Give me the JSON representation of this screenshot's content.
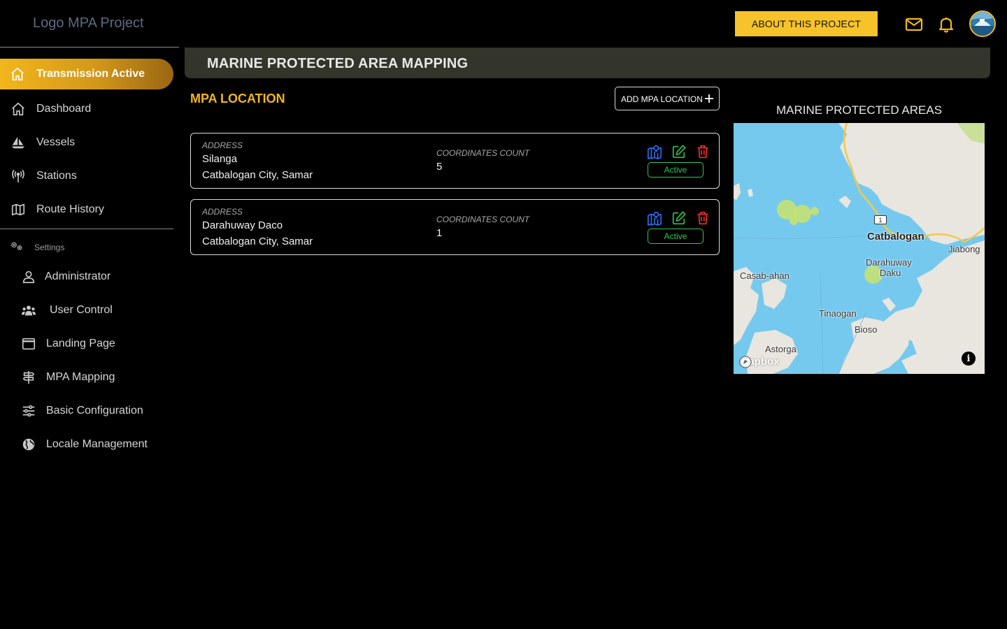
{
  "app": {
    "logo_text": "Logo MPA Project"
  },
  "topbar": {
    "about_label": "ABOUT THIS PROJECT",
    "mail_icon": "mail-icon",
    "bell_icon": "bell-icon"
  },
  "sidebar": {
    "active_item": {
      "label": "Transmission Active",
      "icon": "home-icon"
    },
    "items": [
      {
        "label": "Dashboard",
        "icon": "home-icon"
      },
      {
        "label": "Vessels",
        "icon": "sailboat-icon"
      },
      {
        "label": "Stations",
        "icon": "antenna-icon"
      },
      {
        "label": "Route History",
        "icon": "map-icon"
      }
    ],
    "settings_label": "Settings",
    "settings_items": [
      {
        "label": "Administrator",
        "icon": "user-icon"
      },
      {
        "label": "User Control",
        "icon": "users-icon"
      },
      {
        "label": "Landing Page",
        "icon": "window-icon"
      },
      {
        "label": "MPA Mapping",
        "icon": "signpost-icon"
      },
      {
        "label": "Basic Configuration",
        "icon": "sliders-icon"
      },
      {
        "label": "Locale Management",
        "icon": "globe-icon"
      }
    ]
  },
  "page": {
    "title": "MARINE PROTECTED AREA MAPPING"
  },
  "mpa": {
    "section_title": "MPA LOCATION",
    "add_label": "ADD MPA LOCATION",
    "address_label": "ADDRESS",
    "coords_label": "COORDINATES COUNT",
    "locations": [
      {
        "name": "Silanga",
        "city": "Catbalogan City, Samar",
        "coordinates_count": "5",
        "status": "Active"
      },
      {
        "name": "Darahuway Daco",
        "city": "Catbalogan City, Samar",
        "coordinates_count": "1",
        "status": "Active"
      }
    ]
  },
  "map": {
    "title": "MARINE PROTECTED AREAS",
    "labels": {
      "catbalogan": "Catbalogan",
      "jiabong": "Jiabong",
      "darahuway": "Darahuway",
      "daku": "Daku",
      "casab_ahan": "Casab-ahan",
      "tinaogan": "Tinaogan",
      "bioso": "Bioso",
      "astorga": "Astorga"
    },
    "road_number": "1",
    "attribution": "mapbox",
    "info_symbol": "i",
    "colors": {
      "water": "#76c9ee",
      "land": "#e9e6df",
      "mpa_marker": "#c9e36b",
      "road": "#f2c84b"
    }
  }
}
